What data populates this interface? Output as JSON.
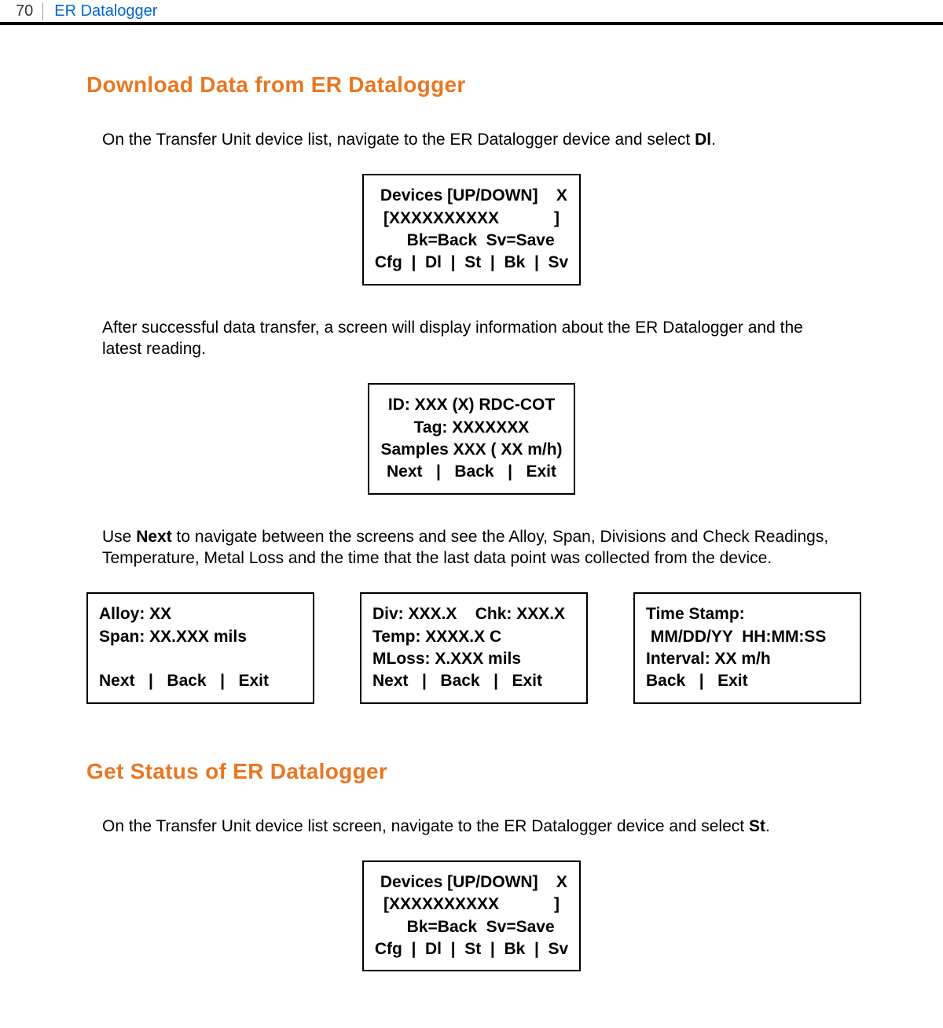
{
  "header": {
    "page_number": "70",
    "title": "ER Datalogger"
  },
  "section1": {
    "title": "Download Data from ER Datalogger",
    "intro_pre": "On the Transfer Unit device list, navigate to the ER Datalogger device and select ",
    "intro_bold": "Dl",
    "intro_post": ".",
    "screen1": " Devices [UP/DOWN]    X\n[XXXXXXXXXX            ]\n    Bk=Back  Sv=Save\nCfg  |  Dl  |  St  |  Bk  |  Sv",
    "para2": "After successful data transfer, a screen will display information about the ER Datalogger and the latest reading.",
    "screen2": "ID: XXX (X) RDC-COT\nTag: XXXXXXX\nSamples XXX ( XX m/h)\nNext   |   Back   |   Exit",
    "para3_pre": "Use ",
    "para3_bold": "Next",
    "para3_post": " to navigate between the screens and see the Alloy, Span, Divisions and Check Readings, Temperature, Metal Loss and the time that the last data point was collected from the device.",
    "screen3": "Alloy: XX\nSpan: XX.XXX mils\n\nNext   |   Back   |   Exit",
    "screen4": "Div: XXX.X    Chk: XXX.X\nTemp: XXXX.X C\nMLoss: X.XXX mils\nNext   |   Back   |   Exit",
    "screen5": "Time Stamp:\n MM/DD/YY  HH:MM:SS\nInterval: XX m/h\nBack   |   Exit"
  },
  "section2": {
    "title": "Get Status of ER Datalogger",
    "intro_pre": "On the Transfer Unit device list screen, navigate to the ER Datalogger device and select ",
    "intro_bold": "St",
    "intro_post": ".",
    "screen1": " Devices [UP/DOWN]    X\n[XXXXXXXXXX            ]\n    Bk=Back  Sv=Save\nCfg  |  Dl  |  St  |  Bk  |  Sv"
  }
}
